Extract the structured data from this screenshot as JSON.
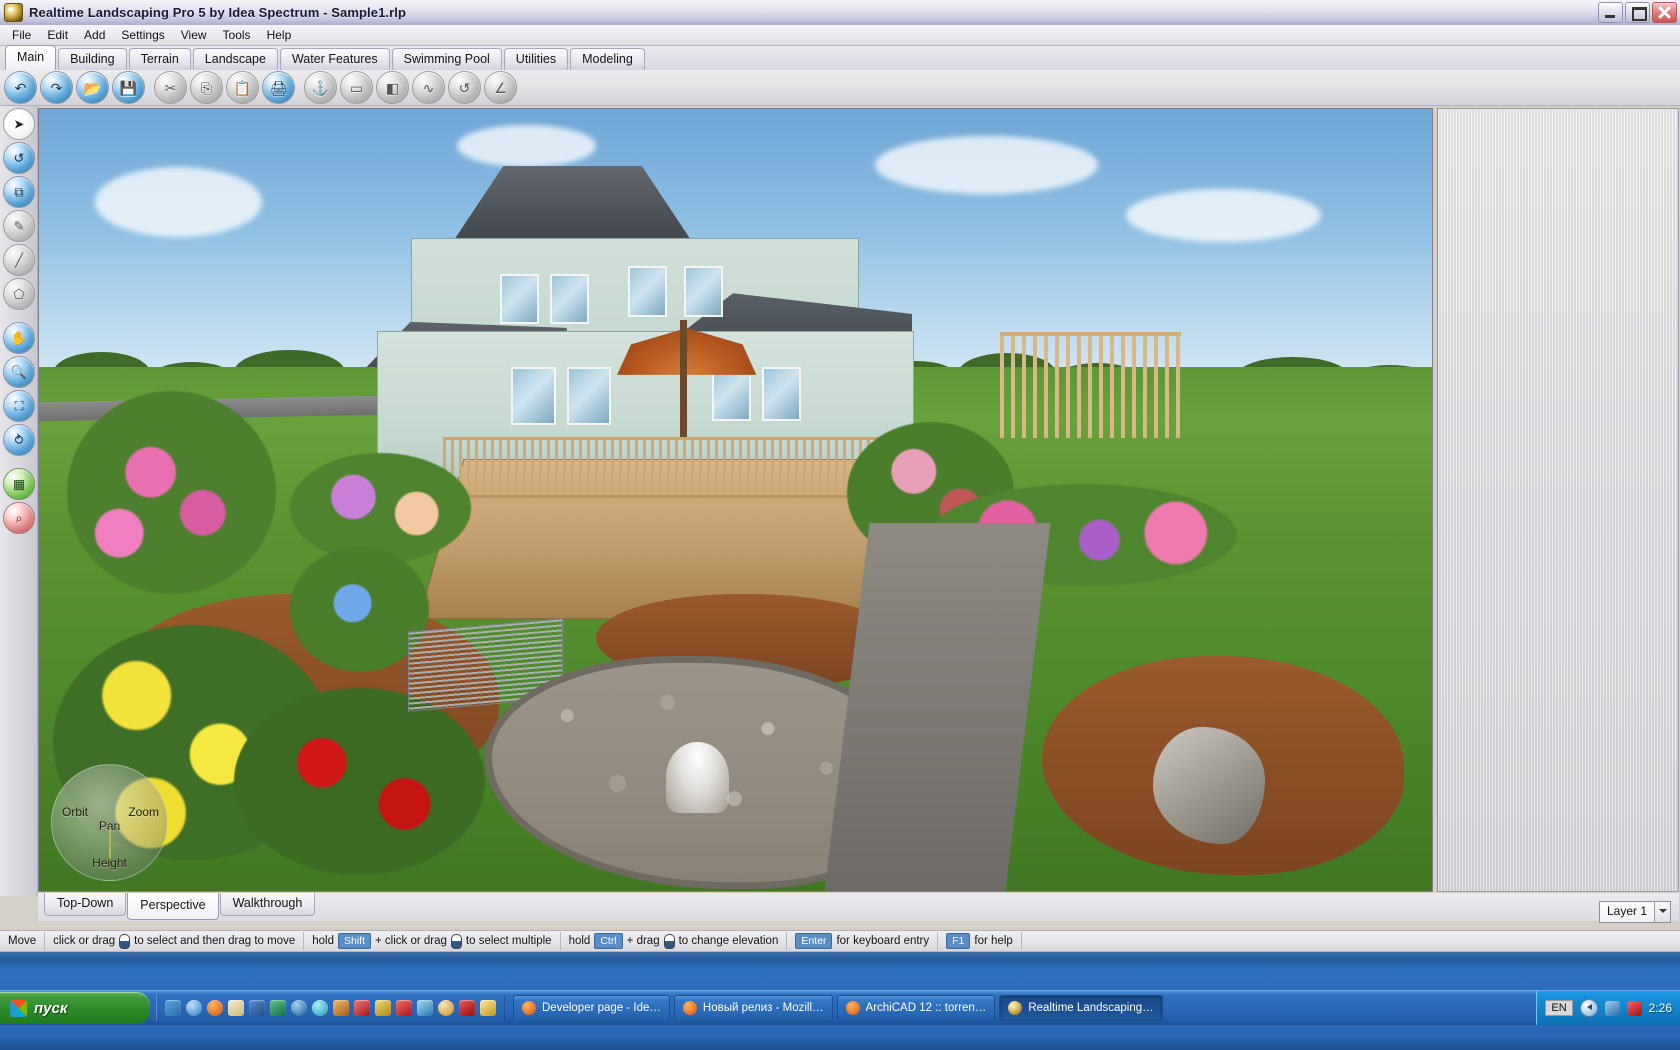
{
  "window": {
    "title": "Realtime Landscaping Pro 5 by Idea Spectrum - Sample1.rlp",
    "app_icon": "app-logo-icon",
    "controls": {
      "minimize": "minimize-icon",
      "maximize": "maximize-icon",
      "close": "close-icon"
    }
  },
  "menubar": {
    "items": [
      "File",
      "Edit",
      "Add",
      "Settings",
      "View",
      "Tools",
      "Help"
    ]
  },
  "ribbon": {
    "tabs": [
      {
        "label": "Main",
        "active": true
      },
      {
        "label": "Building",
        "active": false
      },
      {
        "label": "Terrain",
        "active": false
      },
      {
        "label": "Landscape",
        "active": false
      },
      {
        "label": "Water Features",
        "active": false
      },
      {
        "label": "Swimming Pool",
        "active": false
      },
      {
        "label": "Utilities",
        "active": false
      },
      {
        "label": "Modeling",
        "active": false
      }
    ]
  },
  "toolbar": {
    "buttons": [
      {
        "name": "undo-icon",
        "glyph": "↶",
        "enabled": true
      },
      {
        "name": "redo-icon",
        "glyph": "↷",
        "enabled": true
      },
      {
        "name": "open-file-icon",
        "glyph": "📂",
        "enabled": true
      },
      {
        "name": "save-icon",
        "glyph": "💾",
        "enabled": true
      },
      {
        "name": "cut-icon",
        "glyph": "✂",
        "enabled": false
      },
      {
        "name": "copy-icon",
        "glyph": "⎘",
        "enabled": false
      },
      {
        "name": "paste-icon",
        "glyph": "📋",
        "enabled": false
      },
      {
        "name": "print-icon",
        "glyph": "🖨",
        "enabled": true
      },
      {
        "name": "plant-stake-icon",
        "glyph": "⚓",
        "enabled": true
      },
      {
        "name": "terrain-flatten-icon",
        "glyph": "▭",
        "enabled": true
      },
      {
        "name": "mirror-icon",
        "glyph": "◧",
        "enabled": true
      },
      {
        "name": "spline-icon",
        "glyph": "∿",
        "enabled": false
      },
      {
        "name": "rotate-icon",
        "glyph": "↺",
        "enabled": false
      },
      {
        "name": "angle-icon",
        "glyph": "∠",
        "enabled": false
      }
    ]
  },
  "left_rail": {
    "buttons": [
      {
        "name": "select-arrow-icon",
        "glyph": "➤",
        "style": "white"
      },
      {
        "name": "rotate-object-icon",
        "glyph": "↺",
        "style": "blue"
      },
      {
        "name": "scale-object-icon",
        "glyph": "⧉",
        "style": "blue"
      },
      {
        "name": "draw-freehand-icon",
        "glyph": "✎",
        "style": "gray"
      },
      {
        "name": "draw-line-icon",
        "glyph": "╱",
        "style": "gray"
      },
      {
        "name": "draw-region-icon",
        "glyph": "⬠",
        "style": "gray"
      },
      {
        "name": "pan-hand-icon",
        "glyph": "✋",
        "style": "blue"
      },
      {
        "name": "zoom-icon",
        "glyph": "🔍",
        "style": "blue"
      },
      {
        "name": "zoom-extents-icon",
        "glyph": "⛶",
        "style": "blue"
      },
      {
        "name": "orbit-icon",
        "glyph": "⥁",
        "style": "blue"
      },
      {
        "name": "grid-icon",
        "glyph": "▦",
        "style": "green"
      },
      {
        "name": "magnet-snap-icon",
        "glyph": "⌕",
        "style": "red"
      }
    ]
  },
  "viewport": {
    "compass": {
      "orbit": "Orbit",
      "zoom": "Zoom",
      "pan": "Pan",
      "height": "Height"
    }
  },
  "view_tabs": {
    "tabs": [
      {
        "label": "Top-Down",
        "active": false
      },
      {
        "label": "Perspective",
        "active": true
      },
      {
        "label": "Walkthrough",
        "active": false
      }
    ]
  },
  "layer_selector": {
    "value": "Layer 1",
    "arrow": "chevron-down-icon"
  },
  "statusbar": {
    "mode": "Move",
    "hints": [
      {
        "pre": "click or drag",
        "mouse": true,
        "post": "to select and then drag to move"
      },
      {
        "pre": "hold",
        "key": "Shift",
        "mid": "+ click or drag",
        "mouse": true,
        "post": "to select multiple"
      },
      {
        "pre": "hold",
        "key": "Ctrl",
        "mid": "+ drag",
        "mouse": true,
        "post": "to change elevation"
      },
      {
        "key": "Enter",
        "post": "for keyboard entry"
      },
      {
        "key": "F1",
        "post": "for help"
      }
    ]
  },
  "taskbar": {
    "start_label": "пуск",
    "quick_launch": [
      {
        "name": "show-desktop-icon",
        "color": "#2f7fc0"
      },
      {
        "name": "internet-explorer-icon",
        "color": "#3a8fd8"
      },
      {
        "name": "firefox-icon",
        "color": "#e06a1a"
      },
      {
        "name": "paint-icon",
        "color": "#f0e0b0"
      },
      {
        "name": "word-icon",
        "color": "#2b5797"
      },
      {
        "name": "excel-icon",
        "color": "#1d7044"
      },
      {
        "name": "media-player-icon",
        "color": "#2e6a9e"
      },
      {
        "name": "aimp-icon",
        "color": "#39bcd8"
      },
      {
        "name": "archive-icon",
        "color": "#c87a2a"
      },
      {
        "name": "utility-icon",
        "color": "#c02020"
      },
      {
        "name": "notes-icon",
        "color": "#d8b030"
      },
      {
        "name": "acrobat-icon",
        "color": "#cc2222"
      },
      {
        "name": "battery-icon",
        "color": "#4aa0d8"
      },
      {
        "name": "download-icon",
        "color": "#d0a040"
      },
      {
        "name": "abbyy-icon",
        "color": "#b02020"
      },
      {
        "name": "clock-icon",
        "color": "#e0b020"
      }
    ],
    "tasks": [
      {
        "label": "Developer page - Ide…",
        "icon": "firefox-icon",
        "active": false
      },
      {
        "label": "Новый релиз - Mozill…",
        "icon": "firefox-icon",
        "active": false
      },
      {
        "label": "ArchiCAD 12 :: torren…",
        "icon": "firefox-icon",
        "active": false
      },
      {
        "label": "Realtime Landscaping…",
        "icon": "app-logo-icon",
        "active": true
      }
    ],
    "tray": {
      "language": "EN",
      "chevron": "show-hidden-icons-icon",
      "icons": [
        {
          "name": "network-icon",
          "color": "#4a86c8"
        },
        {
          "name": "volume-icon",
          "color": "#c01818"
        }
      ],
      "clock": "2:26"
    }
  },
  "colors": {
    "title_gradient_start": "#f3f3fa",
    "title_gradient_end": "#aeaecb",
    "taskbar_blue": "#2a66b4",
    "start_green": "#2e8a28",
    "accent_key": "#5b8ec4"
  }
}
